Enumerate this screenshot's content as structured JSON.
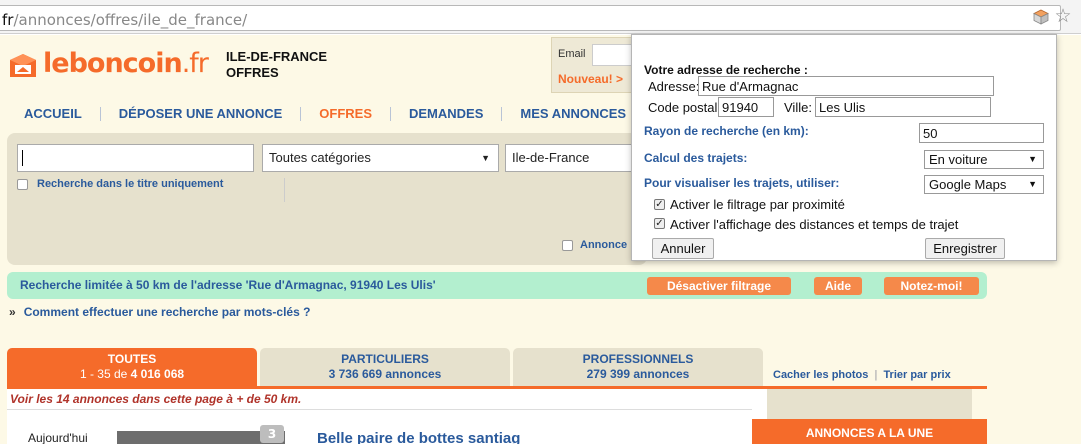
{
  "browser": {
    "url_prefix": "fr",
    "url_path": "/annonces/offres/ile_de_france/"
  },
  "header": {
    "logo_text": "leboncoin",
    "logo_suffix": ".fr",
    "region_line1": "ILE-DE-FRANCE",
    "region_line2": "OFFRES",
    "login_email_label": "Email",
    "login_new_label": "Nouveau! >"
  },
  "nav": {
    "items": [
      {
        "label": "ACCUEIL"
      },
      {
        "label": "DÉPOSER UNE ANNONCE"
      },
      {
        "label": "OFFRES"
      },
      {
        "label": "DEMANDES"
      },
      {
        "label": "MES ANNONCES"
      }
    ]
  },
  "search": {
    "keyword_value": "",
    "category_value": "Toutes catégories",
    "region_value": "Ile-de-France",
    "title_only_label": "Recherche dans le titre uniquement",
    "annonces_label": "Annonce"
  },
  "info": {
    "text": "Recherche limitée à 50 km de l'adresse 'Rue d'Armagnac, 91940 Les Ulis'",
    "btn_disable": "Désactiver filtrage",
    "btn_help": "Aide",
    "btn_rate": "Notez-moi!"
  },
  "howto": {
    "bullet": "»",
    "link": "Comment effectuer une recherche par mots-clés ?"
  },
  "tabs": [
    {
      "title": "TOUTES",
      "range": "1 - 35 de ",
      "count": "4 016 068"
    },
    {
      "title": "PARTICULIERS",
      "count": "3 736 669 annonces"
    },
    {
      "title": "PROFESSIONNELS",
      "count": "279 399 annonces"
    }
  ],
  "tab_links": {
    "hide_photos": "Cacher les photos",
    "sort_price": "Trier par prix"
  },
  "results": {
    "warning": "Voir les 14 annonces dans cette page à + de 50 km.",
    "first_date": "Aujourd'hui",
    "first_badge": "3",
    "first_title": "Belle paire de bottes santiag",
    "sidebar_title": "ANNONCES A LA UNE"
  },
  "popup": {
    "title": "Votre adresse de recherche :",
    "address_label": "Adresse:",
    "address_value": "Rue d'Armagnac",
    "postal_label": "Code postal:",
    "postal_value": "91940",
    "city_label": "Ville:",
    "city_value": "Les Ulis",
    "radius_label": "Rayon de recherche (en km):",
    "radius_value": "50",
    "calc_label": "Calcul des trajets:",
    "calc_value": "En voiture",
    "visual_label": "Pour visualiser les trajets, utiliser:",
    "visual_value": "Google Maps",
    "cb1_label": "Activer le filtrage par proximité",
    "cb2_label": "Activer l'affichage des distances et temps de trajet",
    "cancel_label": "Annuler",
    "save_label": "Enregistrer"
  },
  "colors": {
    "brand_orange": "#f56b2a",
    "link_blue": "#2a5a9c",
    "info_green": "#b3efcf",
    "panel_beige": "#e6e1cd"
  }
}
